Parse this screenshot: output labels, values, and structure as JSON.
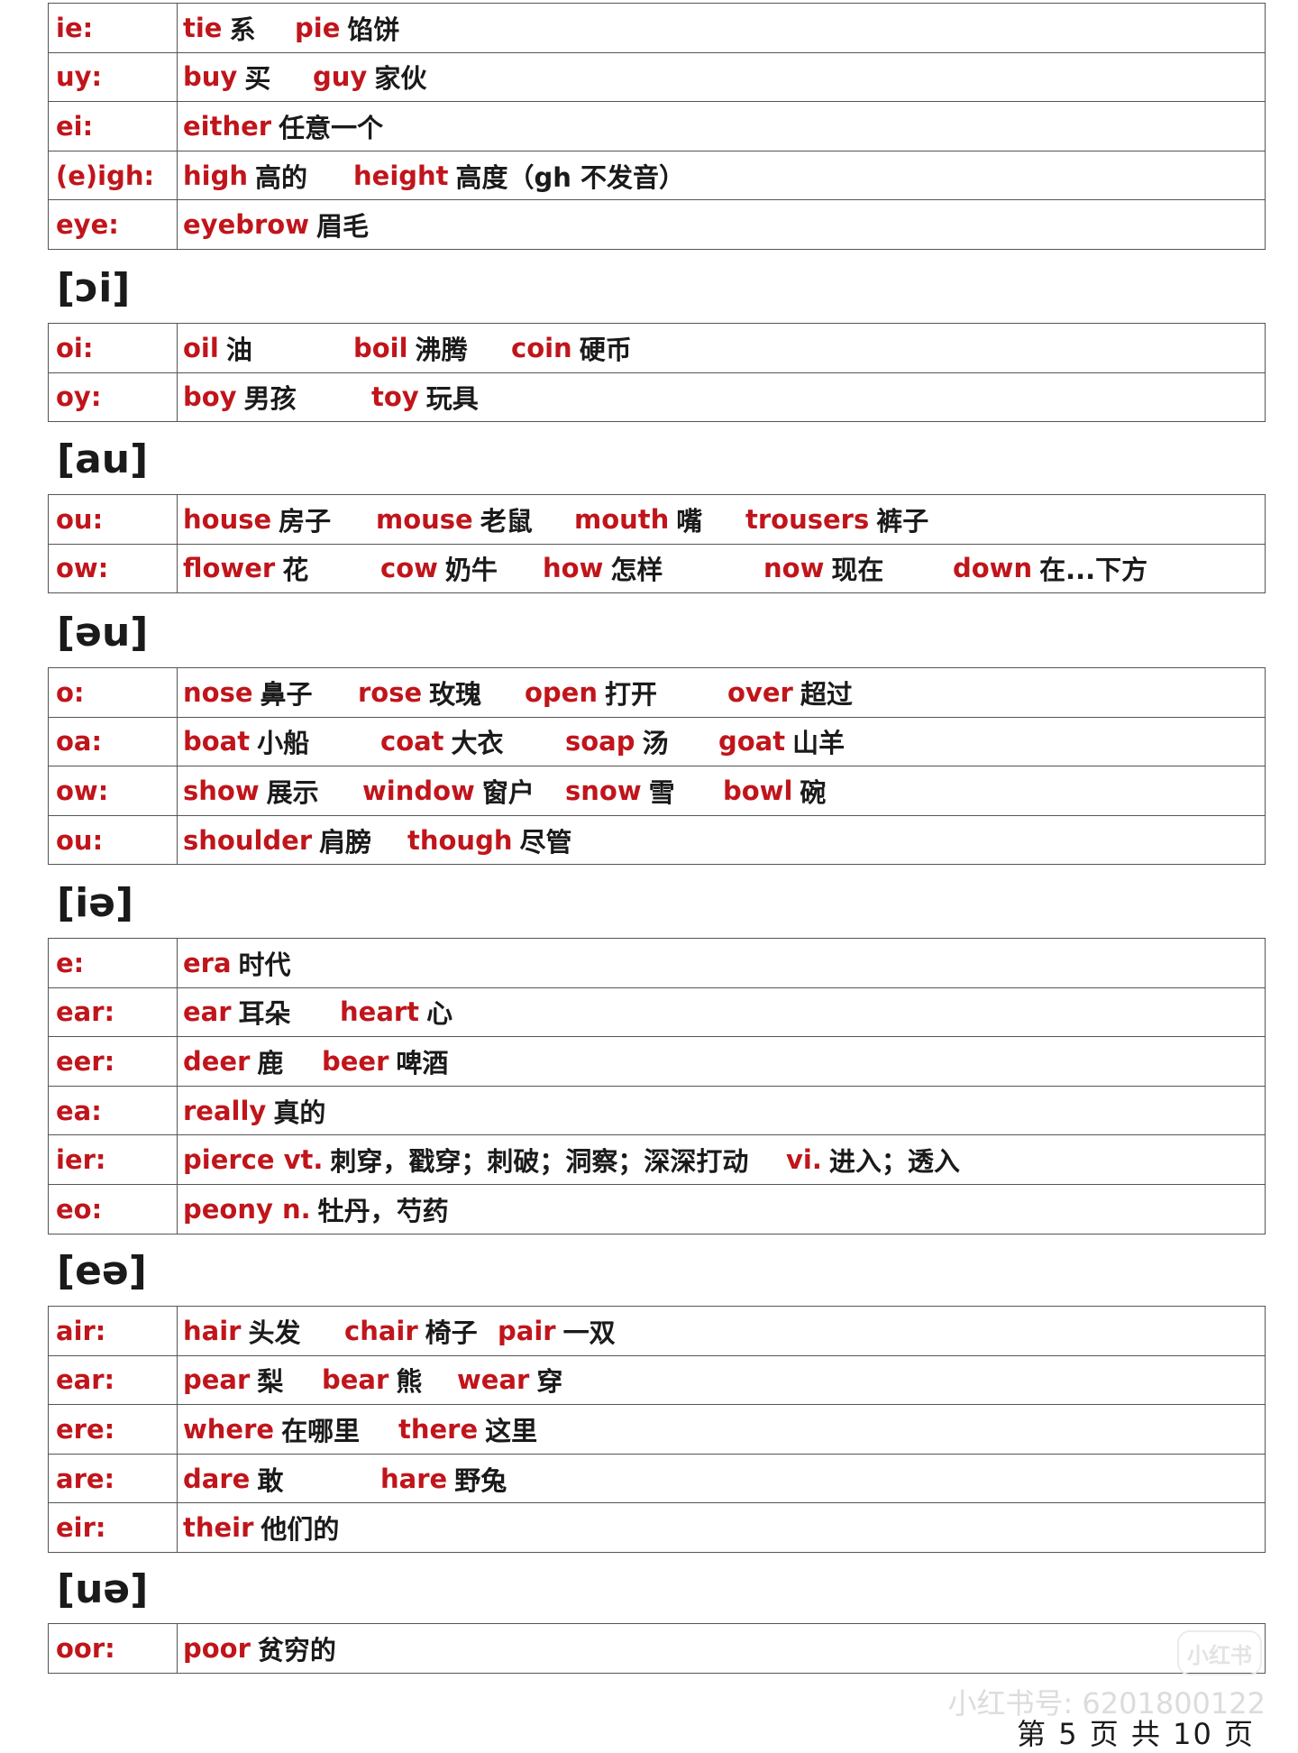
{
  "sections": [
    {
      "heading": "",
      "rows": [
        {
          "key": "ie:",
          "words": [
            {
              "en": "tie",
              "zh": "系"
            },
            {
              "en": "pie",
              "zh": "馅饼"
            }
          ]
        },
        {
          "key": "uy:",
          "words": [
            {
              "en": "buy",
              "zh": "买"
            },
            {
              "en": "guy",
              "zh": "家伙"
            }
          ]
        },
        {
          "key": "ei:",
          "words": [
            {
              "en": "either",
              "zh": "任意一个"
            }
          ]
        },
        {
          "key": "(e)igh:",
          "words": [
            {
              "en": "high",
              "zh": "高的"
            },
            {
              "en": "height",
              "zh": "高度（gh 不发音）"
            }
          ]
        },
        {
          "key": "eye:",
          "words": [
            {
              "en": "eyebrow",
              "zh": "眉毛"
            }
          ]
        }
      ]
    },
    {
      "heading": "[ɔi]",
      "rows": [
        {
          "key": "oi:",
          "words": [
            {
              "en": "oil",
              "zh": "油"
            },
            {
              "en": "boil",
              "zh": "沸腾"
            },
            {
              "en": "coin",
              "zh": "硬币"
            }
          ]
        },
        {
          "key": "oy:",
          "words": [
            {
              "en": "boy",
              "zh": "男孩"
            },
            {
              "en": "toy",
              "zh": "玩具"
            }
          ]
        }
      ]
    },
    {
      "heading": "[au]",
      "rows": [
        {
          "key": "ou:",
          "words": [
            {
              "en": "house",
              "zh": "房子"
            },
            {
              "en": "mouse",
              "zh": "老鼠"
            },
            {
              "en": "mouth",
              "zh": "嘴"
            },
            {
              "en": "trousers",
              "zh": "裤子"
            }
          ]
        },
        {
          "key": "ow:",
          "words": [
            {
              "en": "flower",
              "zh": "花"
            },
            {
              "en": "cow",
              "zh": "奶牛"
            },
            {
              "en": "how",
              "zh": "怎样"
            },
            {
              "en": "now",
              "zh": "现在"
            },
            {
              "en": "down",
              "zh": "在...下方"
            }
          ]
        }
      ]
    },
    {
      "heading": "[əu]",
      "rows": [
        {
          "key": "o:",
          "words": [
            {
              "en": "nose",
              "zh": "鼻子"
            },
            {
              "en": "rose",
              "zh": "玫瑰"
            },
            {
              "en": "open",
              "zh": "打开"
            },
            {
              "en": "over",
              "zh": "超过"
            }
          ]
        },
        {
          "key": "oa:",
          "words": [
            {
              "en": "boat",
              "zh": "小船"
            },
            {
              "en": "coat",
              "zh": "大衣"
            },
            {
              "en": "soap",
              "zh": "汤"
            },
            {
              "en": "goat",
              "zh": "山羊"
            }
          ]
        },
        {
          "key": "ow:",
          "words": [
            {
              "en": "show",
              "zh": "展示"
            },
            {
              "en": "window",
              "zh": "窗户"
            },
            {
              "en": "snow",
              "zh": "雪"
            },
            {
              "en": "bowl",
              "zh": "碗"
            }
          ]
        },
        {
          "key": "ou:",
          "words": [
            {
              "en": "shoulder",
              "zh": "肩膀"
            },
            {
              "en": "though",
              "zh": "尽管"
            }
          ]
        }
      ]
    },
    {
      "heading": "[iə]",
      "rows": [
        {
          "key": "e:",
          "words": [
            {
              "en": "era",
              "zh": "时代"
            }
          ]
        },
        {
          "key": "ear:",
          "words": [
            {
              "en": "ear",
              "zh": "耳朵"
            },
            {
              "en": "heart",
              "zh": "心"
            }
          ]
        },
        {
          "key": "eer:",
          "words": [
            {
              "en": "deer",
              "zh": "鹿"
            },
            {
              "en": "beer",
              "zh": "啤酒"
            }
          ]
        },
        {
          "key": "ea:",
          "words": [
            {
              "en": "really",
              "zh": "真的"
            }
          ]
        },
        {
          "key": "ier:",
          "words": [
            {
              "en": "pierce vt.",
              "zh": "刺穿，戳穿；刺破；洞察；深深打动"
            },
            {
              "en": "vi.",
              "zh": "进入；透入"
            }
          ]
        },
        {
          "key": "eo:",
          "words": [
            {
              "en": "peony n.",
              "zh": "牡丹，芍药"
            }
          ]
        }
      ]
    },
    {
      "heading": "[eə]",
      "rows": [
        {
          "key": "air:",
          "words": [
            {
              "en": "hair",
              "zh": "头发"
            },
            {
              "en": "chair",
              "zh": "椅子"
            },
            {
              "en": "pair",
              "zh": "一双"
            }
          ]
        },
        {
          "key": "ear:",
          "words": [
            {
              "en": "pear",
              "zh": "梨"
            },
            {
              "en": "bear",
              "zh": "熊"
            },
            {
              "en": "wear",
              "zh": "穿"
            }
          ]
        },
        {
          "key": "ere:",
          "words": [
            {
              "en": "where",
              "zh": "在哪里"
            },
            {
              "en": "there",
              "zh": "这里"
            }
          ]
        },
        {
          "key": "are:",
          "words": [
            {
              "en": "dare",
              "zh": "敢"
            },
            {
              "en": "hare",
              "zh": "野兔"
            }
          ]
        },
        {
          "key": "eir:",
          "words": [
            {
              "en": "their",
              "zh": "他们的"
            }
          ]
        }
      ]
    },
    {
      "heading": "[uə]",
      "rows": [
        {
          "key": "oor:",
          "words": [
            {
              "en": "poor",
              "zh": "贫穷的"
            }
          ]
        }
      ]
    }
  ],
  "watermark": "小红书号: 6201800122",
  "watermark_logo": "小红书",
  "footer": "第 5 页 共 10 页"
}
